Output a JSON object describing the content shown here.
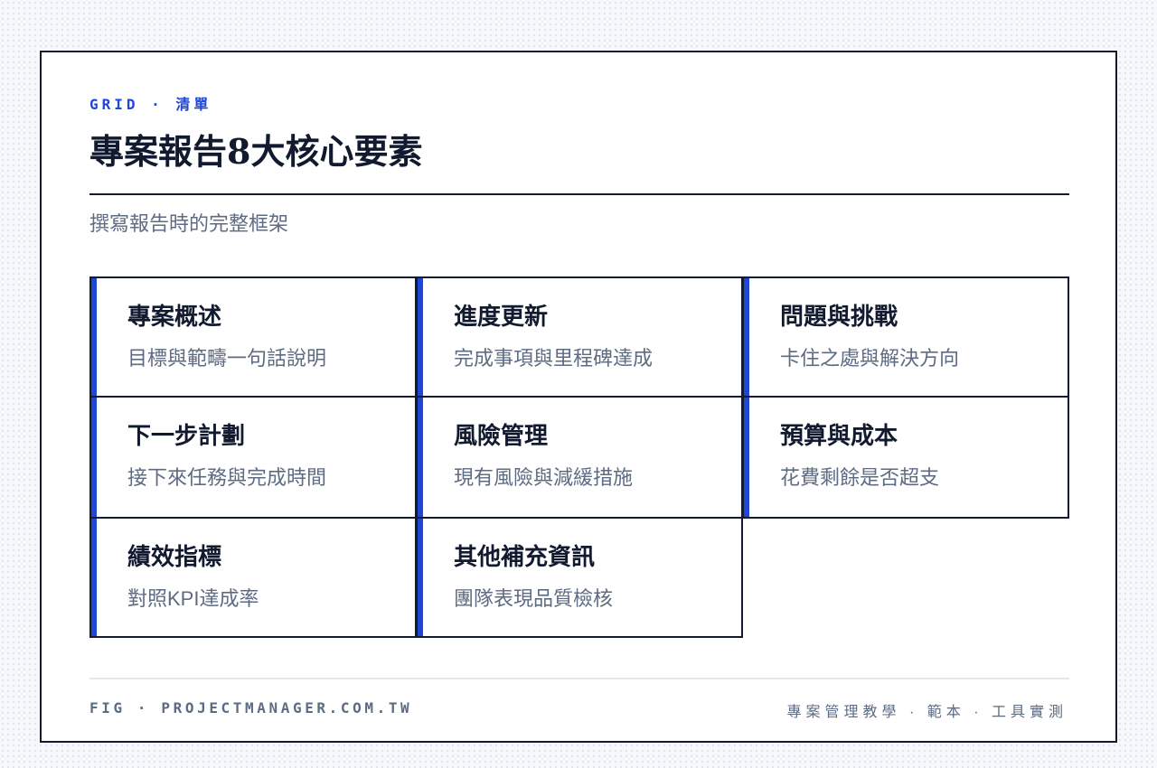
{
  "header": {
    "eyebrow": "GRID · 清單",
    "title": "專案報告8大核心要素",
    "subtitle": "撰寫報告時的完整框架"
  },
  "cards": [
    {
      "title": "專案概述",
      "desc": "目標與範疇一句話說明"
    },
    {
      "title": "進度更新",
      "desc": "完成事項與里程碑達成"
    },
    {
      "title": "問題與挑戰",
      "desc": "卡住之處與解決方向"
    },
    {
      "title": "下一步計劃",
      "desc": "接下來任務與完成時間"
    },
    {
      "title": "風險管理",
      "desc": "現有風險與減緩措施"
    },
    {
      "title": "預算與成本",
      "desc": "花費剩餘是否超支"
    },
    {
      "title": "績效指標",
      "desc": "對照KPI達成率"
    },
    {
      "title": "其他補充資訊",
      "desc": "團隊表現品質檢核"
    }
  ],
  "footer": {
    "left": "FIG · PROJECTMANAGER.COM.TW",
    "right": "專案管理教學 · 範本 · 工具實測"
  },
  "colors": {
    "accent": "#1f47d6",
    "ink": "#111a2e",
    "muted": "#5d6b83"
  }
}
